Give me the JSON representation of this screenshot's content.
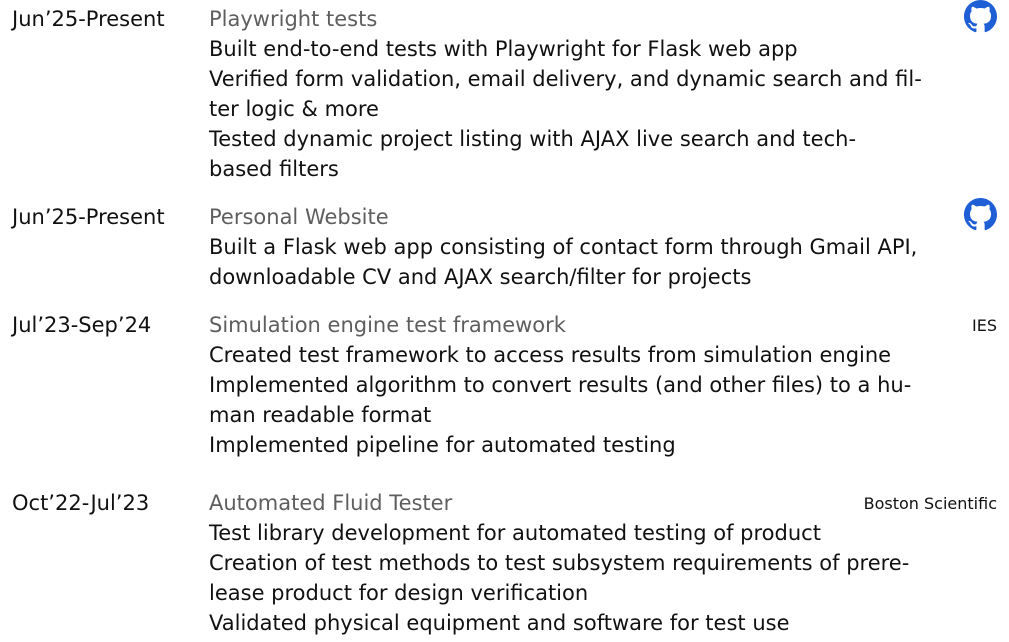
{
  "experience": [
    {
      "date": "Jun’25-Present",
      "title": "Playwright tests",
      "icon": "github-icon",
      "bullets": [
        "Built end-to-end tests with Playwright for Flask web app",
        "Verified form validation, email delivery, and dynamic search and fil-\nter logic & more",
        "Tested dynamic project listing with AJAX live search and tech-\nbased filters"
      ]
    },
    {
      "date": "Jun’25-Present",
      "title": "Personal Website",
      "icon": "github-icon",
      "bullets": [
        "Built a Flask web app consisting of contact form through Gmail API,\ndownloadable CV and AJAX search/filter for projects"
      ]
    },
    {
      "date": "Jul’23-Sep’24",
      "title": "Simulation engine test framework",
      "org": "IES",
      "bullets": [
        "Created test framework to access results from simulation engine",
        "Implemented algorithm to convert results (and other files) to a hu-\nman readable format",
        "Implemented pipeline for automated testing"
      ]
    },
    {
      "date": "Oct’22-Jul’23",
      "title": "Automated Fluid Tester",
      "org": "Boston Scientific",
      "bullets": [
        "Test library development for automated testing of product",
        "Creation of test methods to test subsystem requirements of prere-\nlease product for design verification",
        "Validated physical equipment and software for test use"
      ]
    }
  ],
  "colors": {
    "text": "#111111",
    "title": "#5e5e5e",
    "icon": "#1f5fd6"
  }
}
